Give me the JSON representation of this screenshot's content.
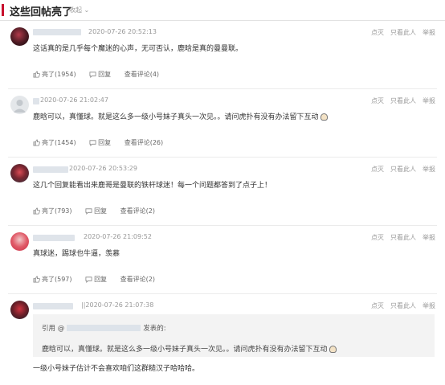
{
  "header": {
    "title": "这些回帖亮了",
    "collapse": "收起"
  },
  "posts": [
    {
      "time": "2020-07-26 20:52:13",
      "content": "这话真的是几乎每个魔迷的心声，无可否认，鹿晗是真的曼曼联。",
      "ops": [
        "点灭",
        "只看此人",
        "举报"
      ],
      "like": "亮了(1954)",
      "reply": "回复",
      "view": "查看评论(4)"
    },
    {
      "time": "2020-07-26 21:02:47",
      "content": "鹿晗可以，真懂球。就是这么多一级小号妹子真头一次见。。请问虎扑有没有办法留下互动",
      "ops": [
        "点灭",
        "只看此人",
        "举报"
      ],
      "like": "亮了(1454)",
      "reply": "回复",
      "view": "查看评论(26)"
    },
    {
      "time": "2020-07-26 20:53:29",
      "content": "这几个回复能看出来鹿哥是曼联的铁杆球迷！每一个问题都答到了点子上！",
      "ops": [
        "点灭",
        "只看此人",
        "举报"
      ],
      "like": "亮了(793)",
      "reply": "回复",
      "view": "查看评论(2)"
    },
    {
      "time": "2020-07-26 21:09:52",
      "content": "真球迷，踢球也牛逼，羡慕",
      "ops": [
        "点灭",
        "只看此人",
        "举报"
      ],
      "like": "亮了(597)",
      "reply": "回复",
      "view": "查看评论(2)"
    },
    {
      "time": "2020-07-26 21:07:38",
      "time_prefix": "||",
      "quote_prefix": "引用 @",
      "quote_suffix": "发表的:",
      "quote_body": "鹿晗可以，真懂球。就是这么多一级小号妹子真头一次见。。请问虎扑有没有办法留下互动",
      "content": "一级小号妹子估计不会喜欢咱们这群糙汉子哈哈哈。",
      "ops": [
        "点灭",
        "只看此人",
        "举报"
      ]
    }
  ]
}
